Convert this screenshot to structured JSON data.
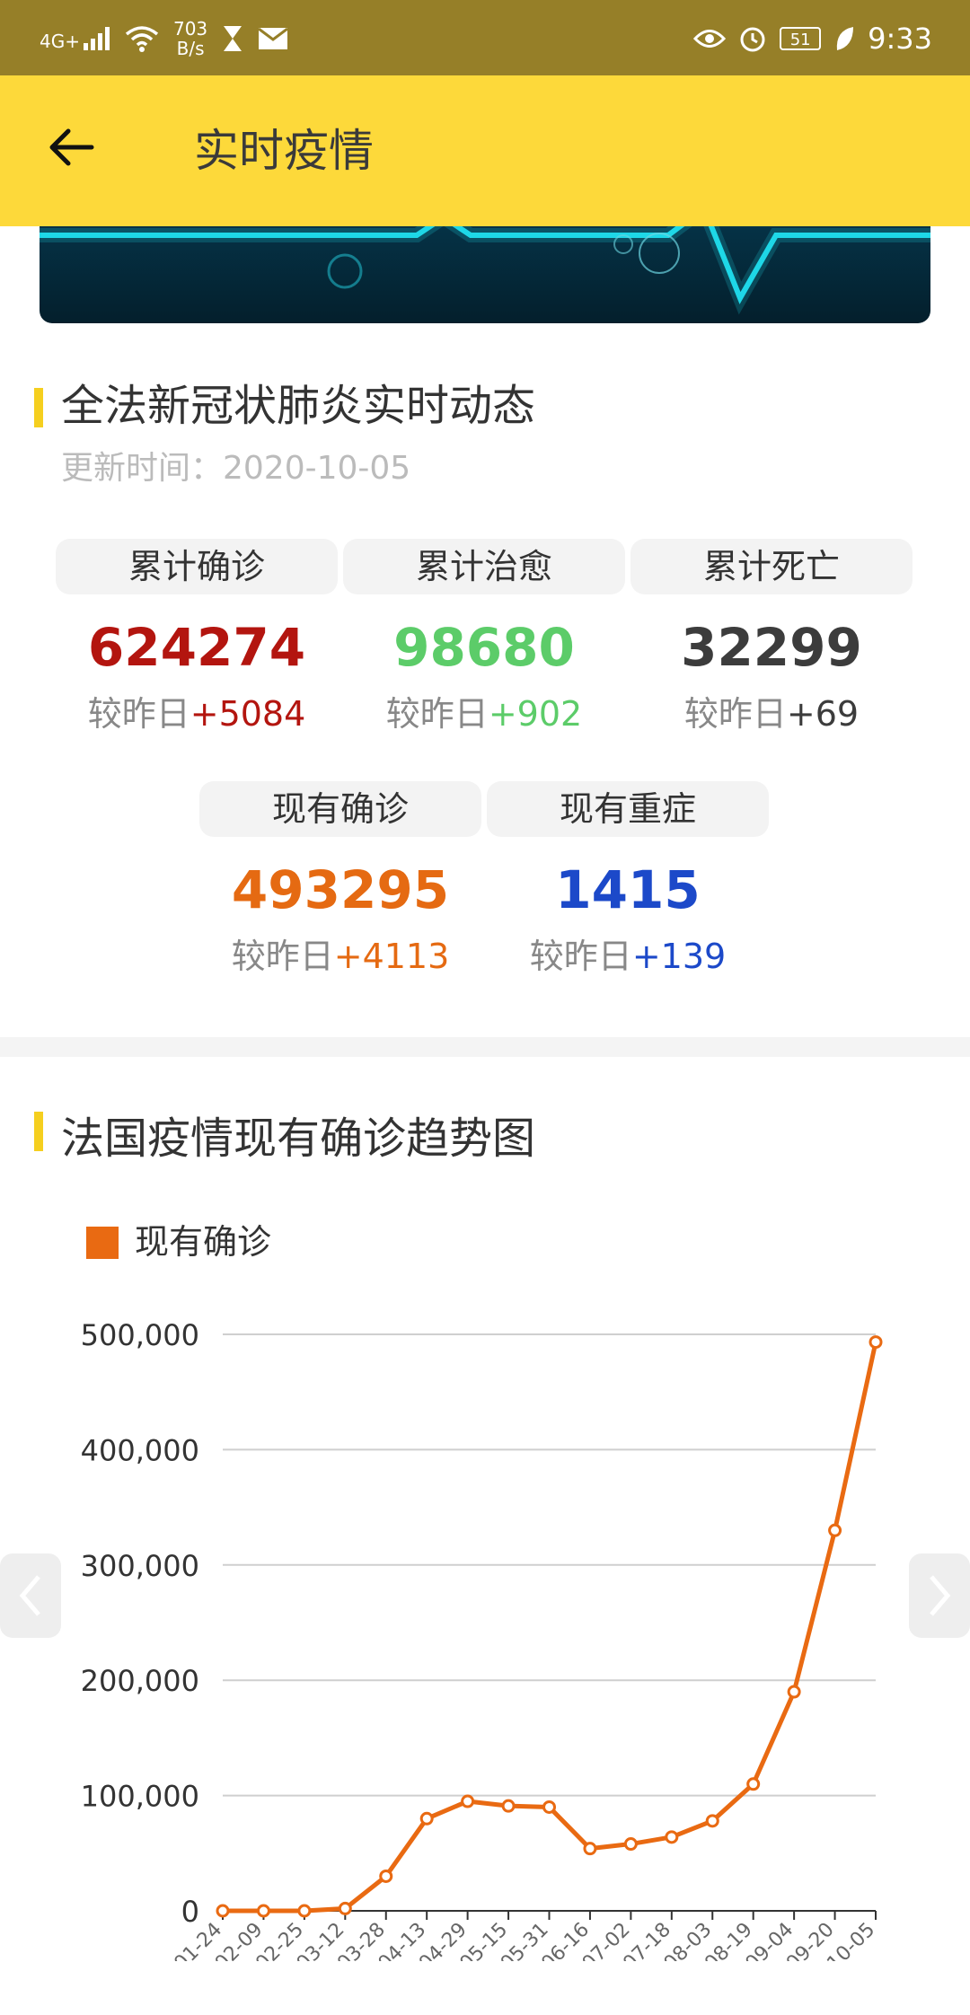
{
  "status_bar": {
    "network": "4G+",
    "speed_value": "703",
    "speed_unit": "B/s",
    "battery": "51",
    "time": "9:33"
  },
  "app_bar": {
    "title": "实时疫情"
  },
  "summary": {
    "title": "全法新冠状肺炎实时动态",
    "update_time": "更新时间：2020-10-05",
    "delta_prefix": "较昨日",
    "stats": [
      {
        "label": "累计确诊",
        "value": "624274",
        "delta": "+5084",
        "color": "#b3150f"
      },
      {
        "label": "累计治愈",
        "value": "98680",
        "delta": "+902",
        "color": "#5ccc69"
      },
      {
        "label": "累计死亡",
        "value": "32299",
        "delta": "+69",
        "color": "#3c3c3c"
      },
      {
        "label": "现有确诊",
        "value": "493295",
        "delta": "+4113",
        "color": "#e56a12"
      },
      {
        "label": "现有重症",
        "value": "1415",
        "delta": "+139",
        "color": "#1c49c9"
      }
    ]
  },
  "trend": {
    "title": "法国疫情现有确诊趋势图",
    "legend": "现有确诊",
    "line_color": "#e96a12"
  },
  "chart_data": {
    "type": "line",
    "x": [
      "01-24",
      "02-09",
      "02-25",
      "03-12",
      "03-28",
      "04-13",
      "04-29",
      "05-15",
      "05-31",
      "06-16",
      "07-02",
      "07-18",
      "08-03",
      "08-19",
      "09-04",
      "09-20",
      "10-05"
    ],
    "series": [
      {
        "name": "现有确诊",
        "values": [
          0,
          0,
          0,
          2000,
          30000,
          80000,
          95000,
          91000,
          90000,
          54000,
          58000,
          64000,
          78000,
          110000,
          190000,
          330000,
          493295
        ]
      }
    ],
    "ylim": [
      0,
      500000
    ],
    "yticks": [
      "0",
      "100,000",
      "200,000",
      "300,000",
      "400,000",
      "500,000"
    ],
    "grid": true,
    "legend_position": "top-left"
  }
}
